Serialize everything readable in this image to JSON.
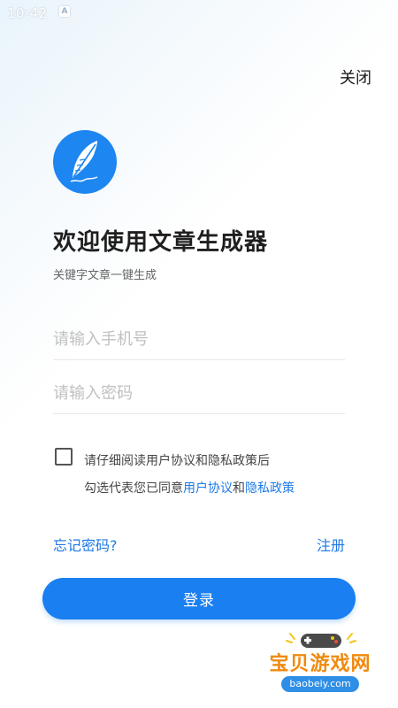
{
  "status_bar": {
    "time": "10:42",
    "notification_letter": "A"
  },
  "header": {
    "close_label": "关闭"
  },
  "logo": {
    "icon": "feather-quill-icon",
    "color": "#1e86f0"
  },
  "title": "欢迎使用文章生成器",
  "subtitle": "关键字文章一键生成",
  "form": {
    "phone_placeholder": "请输入手机号",
    "phone_value": "",
    "password_placeholder": "请输入密码",
    "password_value": ""
  },
  "agreement": {
    "checked": false,
    "line1": "请仔细阅读用户协议和隐私政策后",
    "line2_prefix": "勾选代表您已同意",
    "user_agreement_link": "用户协议",
    "conjunction": "和",
    "privacy_policy_link": "隐私政策"
  },
  "links": {
    "forgot_password": "忘记密码?",
    "register": "注册"
  },
  "login_button_label": "登录",
  "watermark": {
    "name": "宝贝游戏网",
    "domain": "baobeiy.com"
  },
  "colors": {
    "accent": "#1a7ff0",
    "link": "#1e7ae6"
  }
}
